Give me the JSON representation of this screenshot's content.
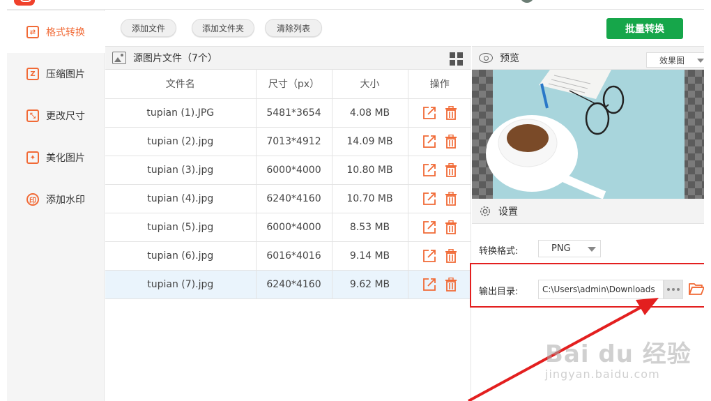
{
  "colors": {
    "accent": "#f16a36",
    "primary_green": "#16a64a",
    "highlight_red": "#e31f1f",
    "selected_row": "#eaf4fc"
  },
  "sidebar": {
    "items": [
      {
        "label": "格式转换",
        "icon": "format-convert-icon",
        "active": true
      },
      {
        "label": "压缩图片",
        "icon": "compress-icon",
        "active": false
      },
      {
        "label": "更改尺寸",
        "icon": "resize-icon",
        "active": false
      },
      {
        "label": "美化图片",
        "icon": "beautify-icon",
        "active": false
      },
      {
        "label": "添加水印",
        "icon": "watermark-icon",
        "active": false
      }
    ]
  },
  "toolbar": {
    "add_file": "添加文件",
    "add_folder": "添加文件夹",
    "clear_list": "清除列表",
    "batch_convert": "批量转换"
  },
  "file_panel": {
    "title": "源图片文件（7个）",
    "columns": [
      "文件名",
      "尺寸（px）",
      "大小",
      "操作"
    ],
    "rows": [
      {
        "name": "tupian (1).JPG",
        "size_px": "5481*3654",
        "size": "4.08 MB"
      },
      {
        "name": "tupian (2).jpg",
        "size_px": "7013*4912",
        "size": "14.09 MB"
      },
      {
        "name": "tupian (3).jpg",
        "size_px": "6000*4000",
        "size": "10.80 MB"
      },
      {
        "name": "tupian (4).jpg",
        "size_px": "6240*4160",
        "size": "10.70 MB"
      },
      {
        "name": "tupian (5).jpg",
        "size_px": "6000*4000",
        "size": "8.53 MB"
      },
      {
        "name": "tupian (6).jpg",
        "size_px": "6016*4016",
        "size": "9.14 MB"
      },
      {
        "name": "tupian (7).jpg",
        "size_px": "6240*4160",
        "size": "9.62 MB"
      }
    ],
    "selected_row": 6
  },
  "preview": {
    "title": "预览",
    "view_mode": "效果图"
  },
  "settings": {
    "title": "设置",
    "format_label": "转换格式:",
    "format_value": "PNG",
    "output_label": "输出目录:",
    "output_value": "C:\\Users\\admin\\Downloads"
  },
  "watermark": {
    "main": "Bai du 经验",
    "sub": "jingyan.baidu.com"
  }
}
